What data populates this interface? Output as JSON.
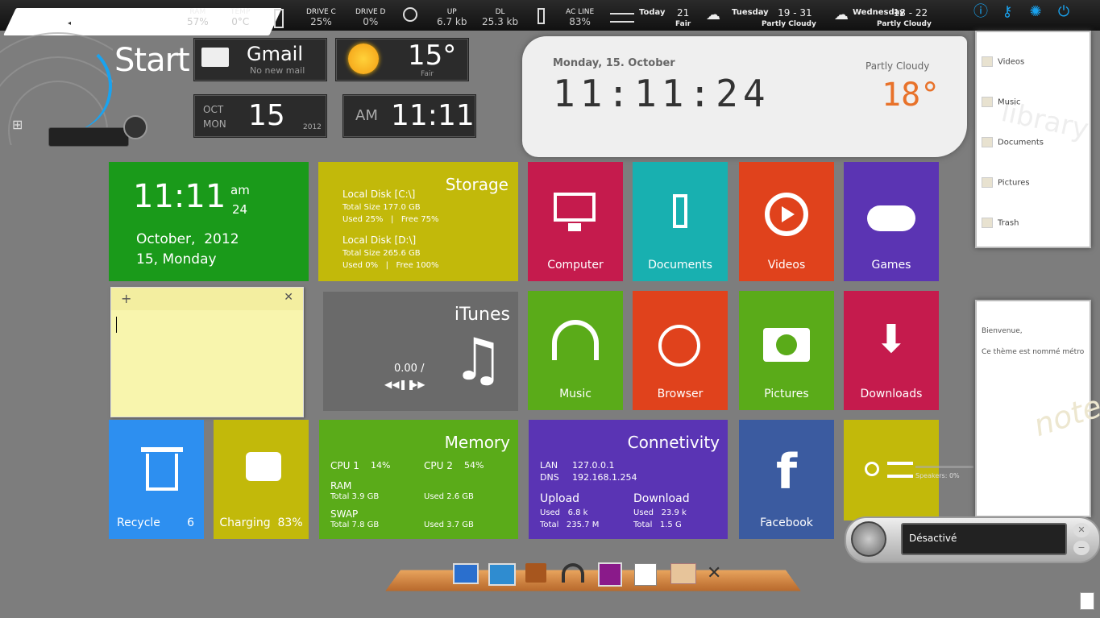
{
  "topbar": {
    "stats": [
      {
        "label": "RAM",
        "value": "57%"
      },
      {
        "label": "TEMP",
        "value": "0°C"
      },
      {
        "label": "DRIVE C",
        "value": "25%"
      },
      {
        "label": "DRIVE D",
        "value": "0%"
      },
      {
        "label": "UP",
        "value": "6.7 kb"
      },
      {
        "label": "DL",
        "value": "25.3 kb"
      },
      {
        "label": "AC LINE",
        "value": "83%"
      }
    ],
    "weather": [
      {
        "day": "Today",
        "temp": "21",
        "cond": "Fair"
      },
      {
        "day": "Tuesday",
        "temp": "19 - 31",
        "cond": "Partly Cloudy"
      },
      {
        "day": "Wednesday",
        "temp": "18 - 22",
        "cond": "Partly Cloudy"
      }
    ]
  },
  "header": {
    "start_label": "Start",
    "gmail_title": "Gmail",
    "gmail_status": "No new mail",
    "weather_temp": "15°",
    "weather_cond": "Fair",
    "date_month": "OCT",
    "date_weekday": "MON",
    "date_day": "15",
    "date_year": "2012",
    "time_ampm": "AM",
    "time_value": "11:11"
  },
  "paper_clock": {
    "date": "Monday, 15. October",
    "time": "11:11:24",
    "condition": "Partly Cloudy",
    "temp": "18°"
  },
  "tiles": {
    "clock": {
      "time": "11:11",
      "ampm": "am",
      "seconds": "24",
      "date_line1": "October,  2012",
      "date_line2": "15, Monday"
    },
    "storage": {
      "title": "Storage",
      "c_title": "Local Disk [C:\\]",
      "c_total": "Total Size  177.0 GB",
      "c_used": "Used 25%   |   Free 75%",
      "d_title": "Local Disk [D:\\]",
      "d_total": "Total Size  265.6 GB",
      "d_used": "Used 0%   |   Free 100%"
    },
    "computer": "Computer",
    "documents": "Documents",
    "videos": "Videos",
    "games": "Games",
    "itunes": {
      "title": "iTunes",
      "time": "0.00 /"
    },
    "music": "Music",
    "browser": "Browser",
    "pictures": "Pictures",
    "downloads": "Downloads",
    "recycle": {
      "label": "Recycle",
      "count": "6"
    },
    "charging": "Charging  83%",
    "memory": {
      "title": "Memory",
      "cpu1_label": "CPU 1",
      "cpu1": "14%",
      "cpu2_label": "CPU 2",
      "cpu2": "54%",
      "ram_label": "RAM",
      "ram_total": "Total 3.9 GB",
      "ram_used": "Used 2.6 GB",
      "swap_label": "SWAP",
      "swap_total": "Total 7.8 GB",
      "swap_used": "Used 3.7 GB"
    },
    "connectivity": {
      "title": "Connetivity",
      "lan_label": "LAN",
      "lan": "127.0.0.1",
      "dns_label": "DNS",
      "dns": "192.168.1.254",
      "upload_label": "Upload",
      "upload_used": "Used   6.8 k",
      "upload_total": "Total   235.7 M",
      "download_label": "Download",
      "download_used": "Used   23.9 k",
      "download_total": "Total   1.5 G"
    },
    "facebook": "Facebook",
    "speakers": "Speakers: 0%"
  },
  "library_panel": {
    "items": [
      "Videos",
      "Music",
      "Documents",
      "Pictures",
      "Trash"
    ],
    "watermark": "library"
  },
  "notes_panel": {
    "line1": "Bienvenue,",
    "line2": "Ce thème est nommé métro",
    "watermark": "note"
  },
  "voice": {
    "status": "Désactivé"
  },
  "colors": {
    "green": "#1a9a1a",
    "olive": "#c2b90a",
    "crimson": "#c51b4d",
    "teal": "#18b0b0",
    "orange": "#e0421c",
    "purple": "#5b34b3",
    "lime": "#5aab19",
    "blue": "#2d8ff0",
    "indigo": "#5a34b4",
    "navy": "#3b5ba0",
    "accent": "#19a3f0"
  }
}
